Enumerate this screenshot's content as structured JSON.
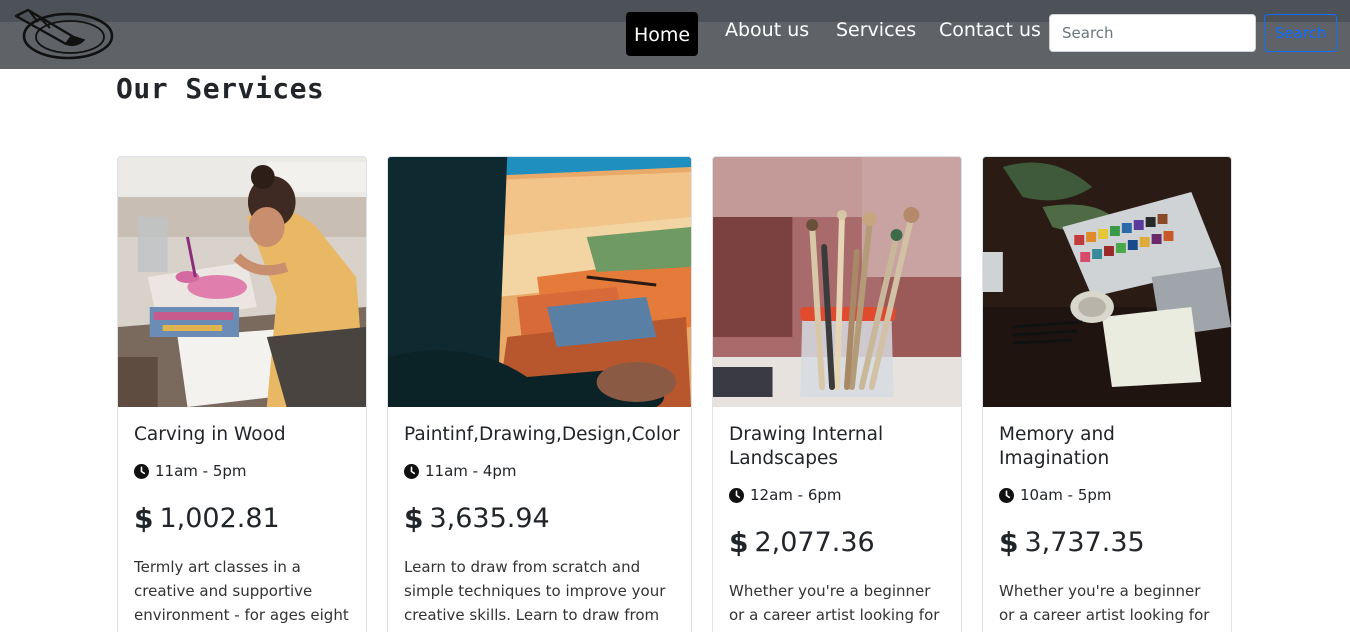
{
  "nav": {
    "logo": "logo",
    "links": [
      "Home",
      "About us",
      "Services",
      "Contact us"
    ],
    "active": "Home",
    "search_placeholder": "Search",
    "search_button": "Search"
  },
  "section_title": "Our Services",
  "cards": [
    {
      "title": "Carving in Wood",
      "time": "11am - 5pm",
      "currency": "$",
      "price": "1,002.81",
      "description": "Termly art classes in a creative and supportive environment - for ages eight and above, with",
      "image": "artist-painting-watercolor-photo"
    },
    {
      "title": "Paintinf,Drawing,Design,Color",
      "time": "11am - 4pm",
      "currency": "$",
      "price": "3,635.94",
      "description": "Learn to draw from scratch and simple techniques to improve your creative skills. Learn to draw from",
      "image": "painting-landscape-canvas-photo"
    },
    {
      "title": "Drawing Internal Landscapes",
      "time": "12am - 6pm",
      "currency": "$",
      "price": "2,077.36",
      "description": "Whether you're a beginner or a career artist looking for",
      "image": "brushes-in-jar-photo"
    },
    {
      "title": "Memory and Imagination",
      "time": "10am - 5pm",
      "currency": "$",
      "price": "3,737.35",
      "description": "Whether you're a beginner or a career artist looking for",
      "image": "watercolor-palette-photo"
    }
  ]
}
